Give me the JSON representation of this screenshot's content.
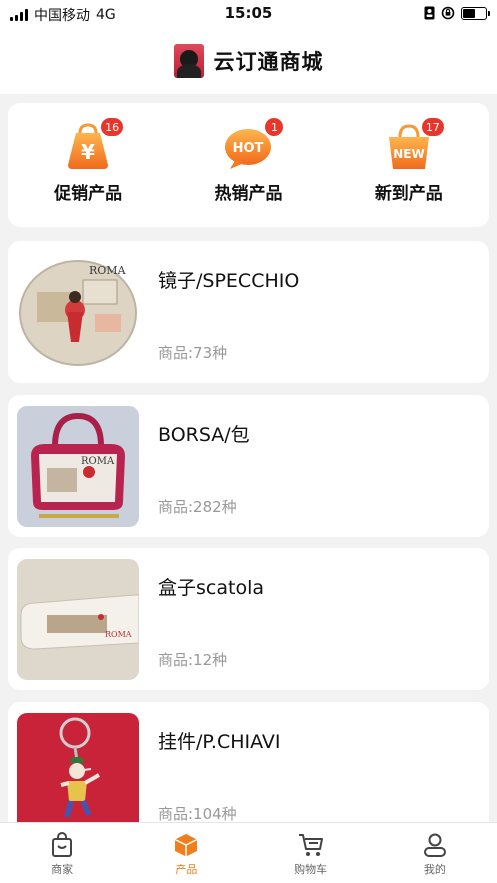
{
  "status_bar": {
    "carrier": "中国移动",
    "network": "4G",
    "time": "15:05"
  },
  "header": {
    "title": "云订通商城"
  },
  "categories": [
    {
      "label": "促销产品",
      "badge": "16",
      "icon": "yuan-bag-icon",
      "icon_text": "¥"
    },
    {
      "label": "热销产品",
      "badge": "1",
      "icon": "hot-bubble-icon",
      "icon_text": "HOT"
    },
    {
      "label": "新到产品",
      "badge": "17",
      "icon": "new-bag-icon",
      "icon_text": "NEW"
    }
  ],
  "products": [
    {
      "name": "镜子/SPECCHIO",
      "count": "商品:73种",
      "image_text": "ROMA"
    },
    {
      "name": "BORSA/包",
      "count": "商品:282种",
      "image_text": "ROMA"
    },
    {
      "name": "盒子scatola",
      "count": "商品:12种",
      "image_text": "ROMA"
    },
    {
      "name": "挂件/P.CHIAVI",
      "count": "商品:104种"
    }
  ],
  "tabs": [
    {
      "label": "商家",
      "icon": "shopping-bag-icon",
      "active": false
    },
    {
      "label": "产品",
      "icon": "box-icon",
      "active": true
    },
    {
      "label": "购物车",
      "icon": "cart-icon",
      "active": false
    },
    {
      "label": "我的",
      "icon": "user-icon",
      "active": false
    }
  ],
  "colors": {
    "accent": "#f07e1a",
    "badge": "#e7372c",
    "background": "#f2f2f2"
  }
}
